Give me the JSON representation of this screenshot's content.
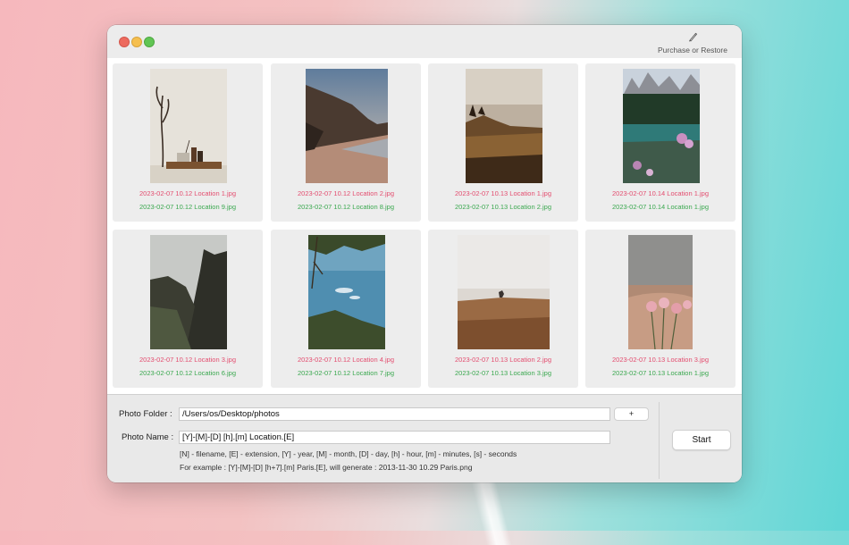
{
  "window": {
    "purchase_label": "Purchase or Restore",
    "colors": {
      "close": "#ed6a5e",
      "minimize": "#f5bf4f",
      "maximize": "#61c554",
      "original_name": "#e34d6f",
      "new_name": "#3aa84f"
    }
  },
  "photos": [
    {
      "original": "2023-02-07 10.12 Location 1.jpg",
      "renamed": "2023-02-07 10.12 Location 9.jpg"
    },
    {
      "original": "2023-02-07 10.12 Location 2.jpg",
      "renamed": "2023-02-07 10.12 Location 8.jpg"
    },
    {
      "original": "2023-02-07 10.13 Location 1.jpg",
      "renamed": "2023-02-07 10.13 Location 2.jpg"
    },
    {
      "original": "2023-02-07 10.14 Location 1.jpg",
      "renamed": "2023-02-07 10.14 Location 1.jpg"
    },
    {
      "original": "2023-02-07 10.12 Location 3.jpg",
      "renamed": "2023-02-07 10.12 Location 6.jpg"
    },
    {
      "original": "2023-02-07 10.12 Location 4.jpg",
      "renamed": "2023-02-07 10.12 Location 7.jpg"
    },
    {
      "original": "2023-02-07 10.13 Location 2.jpg",
      "renamed": "2023-02-07 10.13 Location 3.jpg"
    },
    {
      "original": "2023-02-07 10.13 Location 3.jpg",
      "renamed": "2023-02-07 10.13 Location 1.jpg"
    }
  ],
  "form": {
    "folder_label": "Photo Folder :",
    "folder_value": "/Users/os/Desktop/photos",
    "add_label": "+",
    "name_label": "Photo Name :",
    "name_value": "[Y]-[M]-[D] [h].[m] Location.[E]",
    "help_line1": "[N] - filename, [E] - extension, [Y] - year, [M] - month, [D] - day, [h] - hour, [m] - minutes, [s] - seconds",
    "help_line2": "For example : [Y]-[M]-[D] [h+7].[m] Paris.[E], will generate : 2013-11-30 10.29 Paris.png",
    "start_label": "Start"
  }
}
